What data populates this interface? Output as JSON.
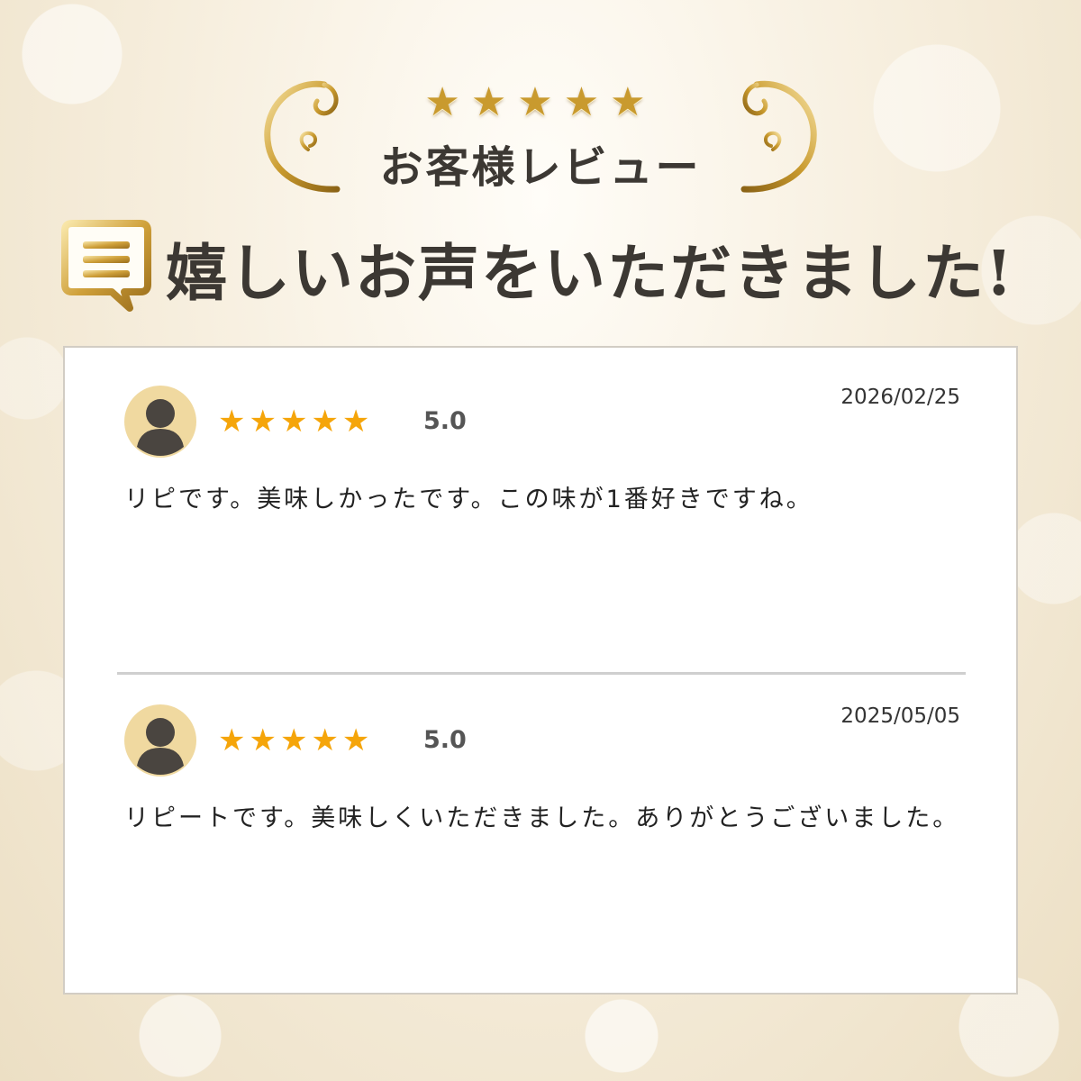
{
  "header": {
    "top_stars": "★★★★★",
    "subtitle": "お客様レビュー",
    "title": "嬉しいお声をいただきました!"
  },
  "reviews": [
    {
      "stars": "★★★★★",
      "rating": "5.0",
      "date": "2026/02/25",
      "comment": "リピです。美味しかったです。この味が1番好きですね。"
    },
    {
      "stars": "★★★★★",
      "rating": "5.0",
      "date": "2025/05/05",
      "comment": "リピートです。美味しくいただきました。ありがとうございました。"
    }
  ],
  "colors": {
    "gold": "#c99a2e",
    "star": "#f5a50a",
    "avatar_bg": "#f0d9a0",
    "avatar_figure": "#4a4540",
    "title_text": "#3c3833"
  },
  "icons": {
    "chat": "speech-bubble-lines",
    "avatar": "person-silhouette"
  }
}
